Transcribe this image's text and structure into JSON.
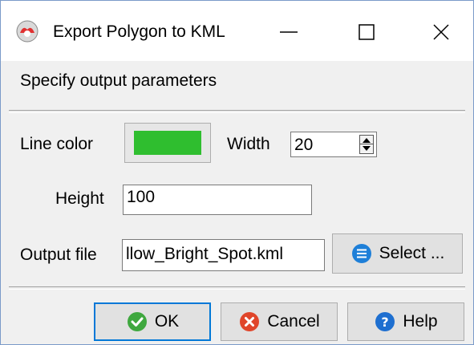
{
  "window": {
    "title": "Export Polygon to KML",
    "minimize_glyph": "—",
    "maximize_glyph": "☐",
    "close_glyph": "✕"
  },
  "header": {
    "label": "Specify output parameters"
  },
  "form": {
    "line_color_label": "Line color",
    "line_color_value": "#2fbe2f",
    "width_label": "Width",
    "width_value": "20",
    "height_label": "Height",
    "height_value": "100",
    "output_file_label": "Output file",
    "output_file_value": "llow_Bright_Spot.kml",
    "select_label": "Select ..."
  },
  "buttons": {
    "ok_label": "OK",
    "cancel_label": "Cancel",
    "help_label": "Help"
  },
  "icons": {
    "app": "app-icon",
    "select": "list-icon",
    "ok": "checkmark-icon",
    "cancel": "cancel-x-icon",
    "help": "question-icon"
  },
  "colors": {
    "accent": "#0078d7",
    "line_color": "#2fbe2f"
  }
}
